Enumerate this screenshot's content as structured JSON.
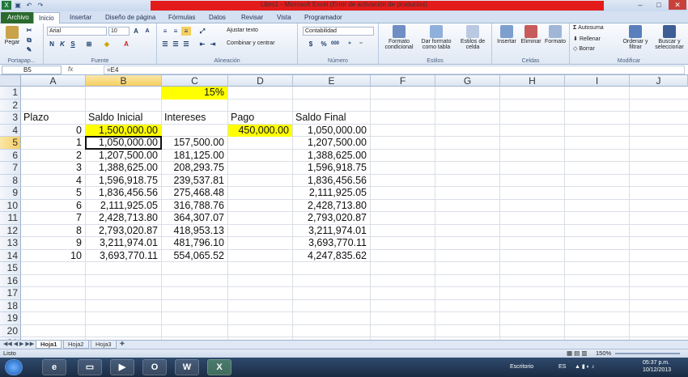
{
  "window": {
    "title": "Libro1 - Microsoft Excel (Error de activación de productos)",
    "quick_access": [
      "save-icon",
      "undo-icon",
      "redo-icon"
    ],
    "controls": [
      "minimize-icon",
      "maximize-icon",
      "close-icon"
    ]
  },
  "tabs": [
    "Archivo",
    "Inicio",
    "Insertar",
    "Diseño de página",
    "Fórmulas",
    "Datos",
    "Revisar",
    "Vista",
    "Programador"
  ],
  "ribbon": {
    "portapapeles": {
      "label": "Portapap...",
      "paste": "Pegar"
    },
    "fuente": {
      "label": "Fuente",
      "font_name": "Arial",
      "font_size": "10",
      "bold": "N",
      "italic": "K",
      "underline": "S"
    },
    "alineacion": {
      "label": "Alineación",
      "wrap": "Ajustar texto",
      "merge": "Combinar y centrar"
    },
    "numero": {
      "label": "Número",
      "format": "Contabilidad",
      "currency": "$",
      "percent": "%",
      "thousands": "000"
    },
    "estilos": {
      "label": "Estilos",
      "cond_format": "Formato condicional",
      "table_format": "Dar formato como tabla",
      "cell_styles": "Estilos de celda"
    },
    "celdas": {
      "label": "Celdas",
      "insert": "Insertar",
      "delete": "Eliminar",
      "format": "Formato"
    },
    "modificar": {
      "label": "Modificar",
      "autosum": "Autosuma",
      "fill": "Rellenar",
      "clear": "Borrar",
      "sort": "Ordenar y filtrar",
      "find": "Buscar y seleccionar"
    }
  },
  "formula_bar": {
    "name_box": "B5",
    "fx": "fx",
    "formula": "=E4"
  },
  "sheet": {
    "columns": [
      "A",
      "B",
      "C",
      "D",
      "E",
      "F",
      "G",
      "H",
      "I",
      "J"
    ],
    "rows": [
      "1",
      "2",
      "3",
      "4",
      "5",
      "6",
      "7",
      "8",
      "9",
      "10",
      "11",
      "12",
      "13",
      "14",
      "15",
      "16",
      "17",
      "18",
      "19",
      "20",
      "21"
    ],
    "rate": "15%",
    "headers": {
      "plazo": "Plazo",
      "saldo_inicial": "Saldo Inicial",
      "intereses": "Intereses",
      "pago": "Pago",
      "saldo_final": "Saldo Final"
    },
    "pago_value": "450,000.00",
    "data": [
      {
        "plazo": "0",
        "saldo_inicial": "1,500,000.00",
        "intereses": "",
        "saldo_final": "1,050,000.00"
      },
      {
        "plazo": "1",
        "saldo_inicial": "1,050,000.00",
        "intereses": "157,500.00",
        "saldo_final": "1,207,500.00"
      },
      {
        "plazo": "2",
        "saldo_inicial": "1,207,500.00",
        "intereses": "181,125.00",
        "saldo_final": "1,388,625.00"
      },
      {
        "plazo": "3",
        "saldo_inicial": "1,388,625.00",
        "intereses": "208,293.75",
        "saldo_final": "1,596,918.75"
      },
      {
        "plazo": "4",
        "saldo_inicial": "1,596,918.75",
        "intereses": "239,537.81",
        "saldo_final": "1,836,456.56"
      },
      {
        "plazo": "5",
        "saldo_inicial": "1,836,456.56",
        "intereses": "275,468.48",
        "saldo_final": "2,111,925.05"
      },
      {
        "plazo": "6",
        "saldo_inicial": "2,111,925.05",
        "intereses": "316,788.76",
        "saldo_final": "2,428,713.80"
      },
      {
        "plazo": "7",
        "saldo_inicial": "2,428,713.80",
        "intereses": "364,307.07",
        "saldo_final": "2,793,020.87"
      },
      {
        "plazo": "8",
        "saldo_inicial": "2,793,020.87",
        "intereses": "418,953.13",
        "saldo_final": "3,211,974.01"
      },
      {
        "plazo": "9",
        "saldo_inicial": "3,211,974.01",
        "intereses": "481,796.10",
        "saldo_final": "3,693,770.11"
      },
      {
        "plazo": "10",
        "saldo_inicial": "3,693,770.11",
        "intereses": "554,065.52",
        "saldo_final": "4,247,835.62"
      }
    ]
  },
  "sheet_tabs": [
    "Hoja1",
    "Hoja2",
    "Hoja3"
  ],
  "status": {
    "mode": "Listo",
    "zoom": "150%"
  },
  "taskbar": {
    "apps": [
      "ie-icon",
      "explorer-icon",
      "media-icon",
      "outlook-icon",
      "word-icon",
      "excel-icon"
    ],
    "desktop": "Escritorio",
    "lang": "ES",
    "time": "05:37 p.m.",
    "date": "10/12/2013"
  },
  "colors": {
    "highlight": "#ffff00",
    "file_tab": "#2b6a2f",
    "title_bar_warning": "#e41b1b"
  }
}
